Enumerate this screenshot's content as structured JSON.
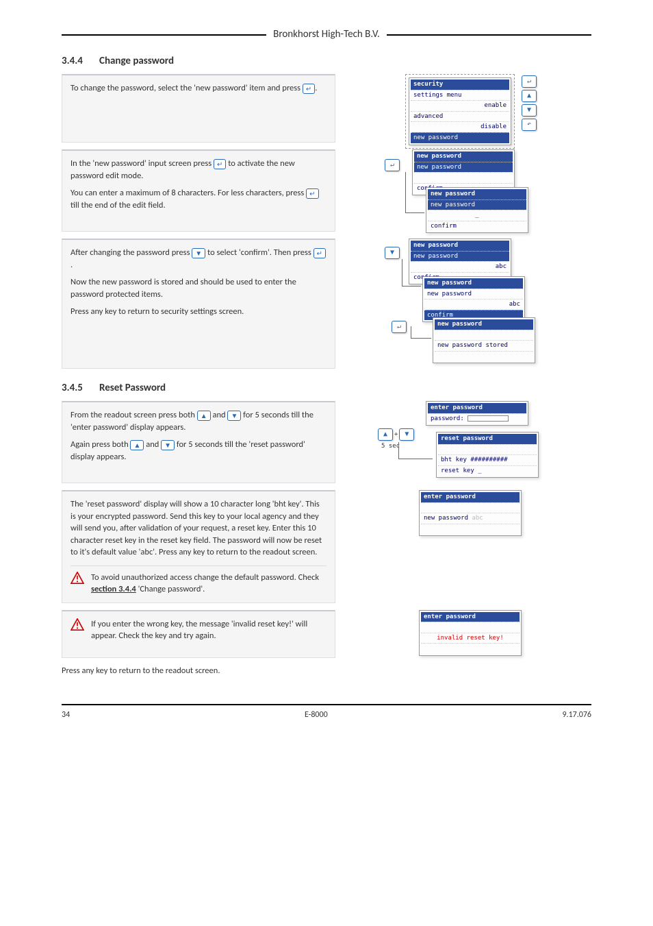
{
  "header": {
    "company": "Bronkhorst High-Tech B.V."
  },
  "sections": {
    "changePassword": {
      "number": "3.4.4",
      "title": "Change password",
      "blocks": {
        "b1": {
          "t1a": "To change the password, select the 'new password' item and press ",
          "t1b": "."
        },
        "b2": {
          "t1a": "In the 'new password' input screen press ",
          "t1b": " to activate the new password edit mode.",
          "t2a": "You can enter a maximum of 8 characters. For less characters, press ",
          "t2b": " till the end of the edit field."
        },
        "b3": {
          "t1a": "After changing the password press ",
          "t1b": " to select 'confirm'. Then press ",
          "t1c": ".",
          "t2": "Now the new password is stored and should be used to enter the password protected items.",
          "t3": "Press any key to return to security settings screen."
        }
      }
    },
    "resetPassword": {
      "number": "3.4.5",
      "title": "Reset Password",
      "blocks": {
        "b1": {
          "t1a": "From the readout screen press both ",
          "t1b": " and ",
          "t1c": " for 5 seconds till the 'enter password' display appears.",
          "t2a": "Again press both ",
          "t2b": " and ",
          "t2c": " for 5 seconds till the 'reset password' display appears."
        },
        "b2": {
          "t1": "The 'reset password' display will show a 10 character long 'bht key'. This is your encrypted password. Send this key to your local agency and they will send you, after validation of your request, a reset key. Enter this 10 character reset key in the reset key field. The password will now be reset to it's default value 'abc'. Press any key to return to the readout screen.",
          "warn": {
            "a": "To avoid unauthorized access change the default password. Check ",
            "link": "section 3.4.4",
            "b": " 'Change password'."
          }
        },
        "b3": {
          "warn": "If you enter the wrong key, the message 'invalid reset key!' will appear. Check the key and try again."
        },
        "b4": {
          "t1": "Press any key to return to the readout screen."
        }
      }
    }
  },
  "diagrams": {
    "d1": {
      "title": "security",
      "lines": [
        "settings menu",
        "enable",
        "advanced",
        "disable"
      ],
      "hl": "new password"
    },
    "d2": {
      "title1": "new password",
      "hl1": "new password",
      "c1": "confirm",
      "title2": "new password",
      "hl2": "new password",
      "c2": "confirm"
    },
    "d3": {
      "title1": "new password",
      "l1a": "new password",
      "l1b": "abc",
      "c1": "confirm",
      "title2": "new password",
      "l2a": "new password",
      "l2b": "abc",
      "hl2": "confirm",
      "title3": "new password",
      "stored": "new password stored"
    },
    "d4": {
      "title1": "enter password",
      "label1": "password:",
      "title2": "reset password",
      "bht": "bht key ##########",
      "rk": "reset key _",
      "fivesec": "5 sec"
    },
    "d5": {
      "title": "enter password",
      "line": "new password ",
      "faded": "abc"
    },
    "d6": {
      "title": "enter password",
      "line": "invalid reset key!"
    }
  },
  "keys": {
    "enter": "↵",
    "up": "▲",
    "down": "▼",
    "undo": "↶",
    "plus": "+"
  },
  "footer": {
    "page": "34",
    "doc": "E-8000",
    "rev": "9.17.076"
  }
}
